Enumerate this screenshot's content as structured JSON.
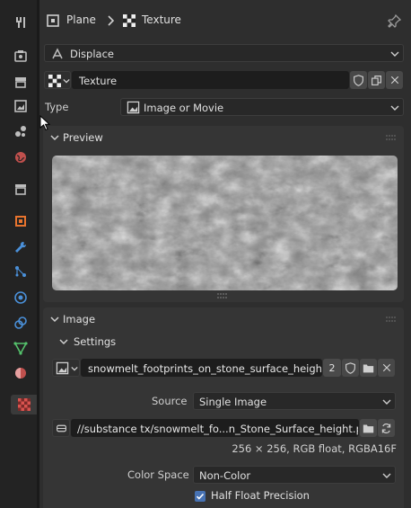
{
  "sidebar": {
    "tabs": [
      {
        "icon": "tool-icon",
        "color": "#bdbdbd"
      },
      {
        "icon": "render-icon",
        "color": "#bdbdbd"
      },
      {
        "icon": "output-icon",
        "color": "#bdbdbd"
      },
      {
        "icon": "view-layer-icon",
        "color": "#bdbdbd"
      },
      {
        "icon": "scene-icon",
        "color": "#bdbdbd"
      },
      {
        "icon": "world-icon",
        "color": "#c0504d"
      },
      {
        "icon": "collection-icon",
        "color": "#bdbdbd"
      },
      {
        "icon": "object-icon",
        "color": "#e8742e"
      },
      {
        "icon": "modifier-icon",
        "color": "#4a90d9"
      },
      {
        "icon": "particles-icon",
        "color": "#4a90d9"
      },
      {
        "icon": "physics-icon",
        "color": "#4a90d9"
      },
      {
        "icon": "constraints-icon",
        "color": "#4a90d9"
      },
      {
        "icon": "data-icon",
        "color": "#55c26c"
      },
      {
        "icon": "material-icon",
        "color": "#c0504d"
      },
      {
        "icon": "texture-icon",
        "color": "#c0504d"
      }
    ]
  },
  "header": {
    "object_name": "Plane",
    "texture_name": "Texture"
  },
  "modifier_select": {
    "value": "Displace"
  },
  "texture_block": {
    "name": "Texture"
  },
  "type_row": {
    "label": "Type",
    "value": "Image or Movie"
  },
  "preview_panel": {
    "title": "Preview"
  },
  "image_panel": {
    "title": "Image",
    "settings_title": "Settings",
    "image_name": "snowmelt_footprints_on_stone_surface_height",
    "users_count": "2",
    "source_label": "Source",
    "source_value": "Single Image",
    "filepath": "//substance tx/snowmelt_fo...n_Stone_Surface_height.png",
    "info": "256 × 256,  RGB float,  RGBA16F",
    "color_space_label": "Color Space",
    "color_space_value": "Non-Color",
    "half_float_label": "Half Float Precision",
    "half_float_checked": true
  },
  "colors": {
    "accent": "#4772b3",
    "checkbox": "#4772b3"
  }
}
